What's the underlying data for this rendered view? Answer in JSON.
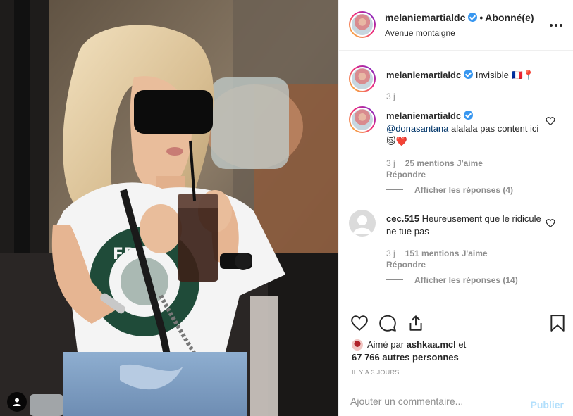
{
  "post": {
    "image_description_icon": "photo",
    "user_tag_icon": "user-tag-icon"
  },
  "header": {
    "username": "melaniemartialdc",
    "verified_icon": "verified-badge-icon",
    "separator": "•",
    "follow_status": "Abonné(e)",
    "location": "Avenue montaigne",
    "more_icon": "more-options-icon"
  },
  "caption": {
    "username": "melaniemartialdc",
    "text": "Invisible",
    "emoji": "🇫🇷📍",
    "time": "3 j"
  },
  "comments": [
    {
      "username": "melaniemartialdc",
      "mention": "@donasantana",
      "text": " alalala pas content ici ",
      "emoji": "😿❤️",
      "time": "3 j",
      "likes": "25 mentions J'aime",
      "reply": "Répondre",
      "view_replies": "Afficher les réponses (4)"
    },
    {
      "username": "cec.515",
      "text": " Heureusement que le ridicule ne tue pas",
      "time": "3 j",
      "likes": "151 mentions J'aime",
      "reply": "Répondre",
      "view_replies": "Afficher les réponses (14)"
    }
  ],
  "actions": {
    "like_icon": "heart-icon",
    "comment_icon": "comment-icon",
    "share_icon": "share-icon",
    "save_icon": "bookmark-icon"
  },
  "likes": {
    "prefix": "Aimé par",
    "first_user": "ashkaa.mcl",
    "and": "et",
    "count": "67 766",
    "others": "autres personnes"
  },
  "timestamp": "IL Y A 3 JOURS",
  "comment_box": {
    "placeholder": "Ajouter un commentaire...",
    "publish_label": "Publier"
  },
  "colors": {
    "accent": "#3897f0",
    "publish_disabled": "#b2dffc",
    "secondary_text": "#8e8e8e",
    "border": "#efefef"
  }
}
